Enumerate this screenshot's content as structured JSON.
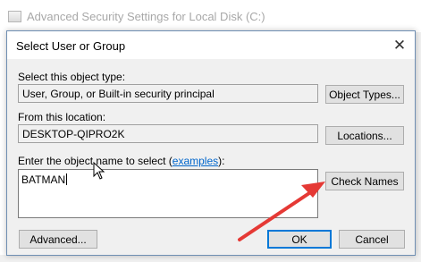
{
  "background_window": {
    "title": "Advanced Security Settings for Local Disk (C:)"
  },
  "dialog": {
    "title": "Select User or Group",
    "close_glyph": "✕",
    "object_type": {
      "label": "Select this object type:",
      "value": "User, Group, or Built-in security principal",
      "button": "Object Types..."
    },
    "location": {
      "label": "From this location:",
      "value": "DESKTOP-QIPRO2K",
      "button": "Locations..."
    },
    "names": {
      "label_prefix": "Enter the object name to select (",
      "label_link": "examples",
      "label_suffix": "):",
      "value": "BATMAN",
      "check_button": "Check Names"
    },
    "buttons": {
      "advanced": "Advanced...",
      "ok": "OK",
      "cancel": "Cancel"
    }
  },
  "annotation": {
    "arrow_color": "#e53935",
    "points_to": "check-names-button"
  },
  "colors": {
    "dialog_bg": "#f0f0f0",
    "default_button_border": "#0078d7",
    "link": "#0066cc"
  }
}
